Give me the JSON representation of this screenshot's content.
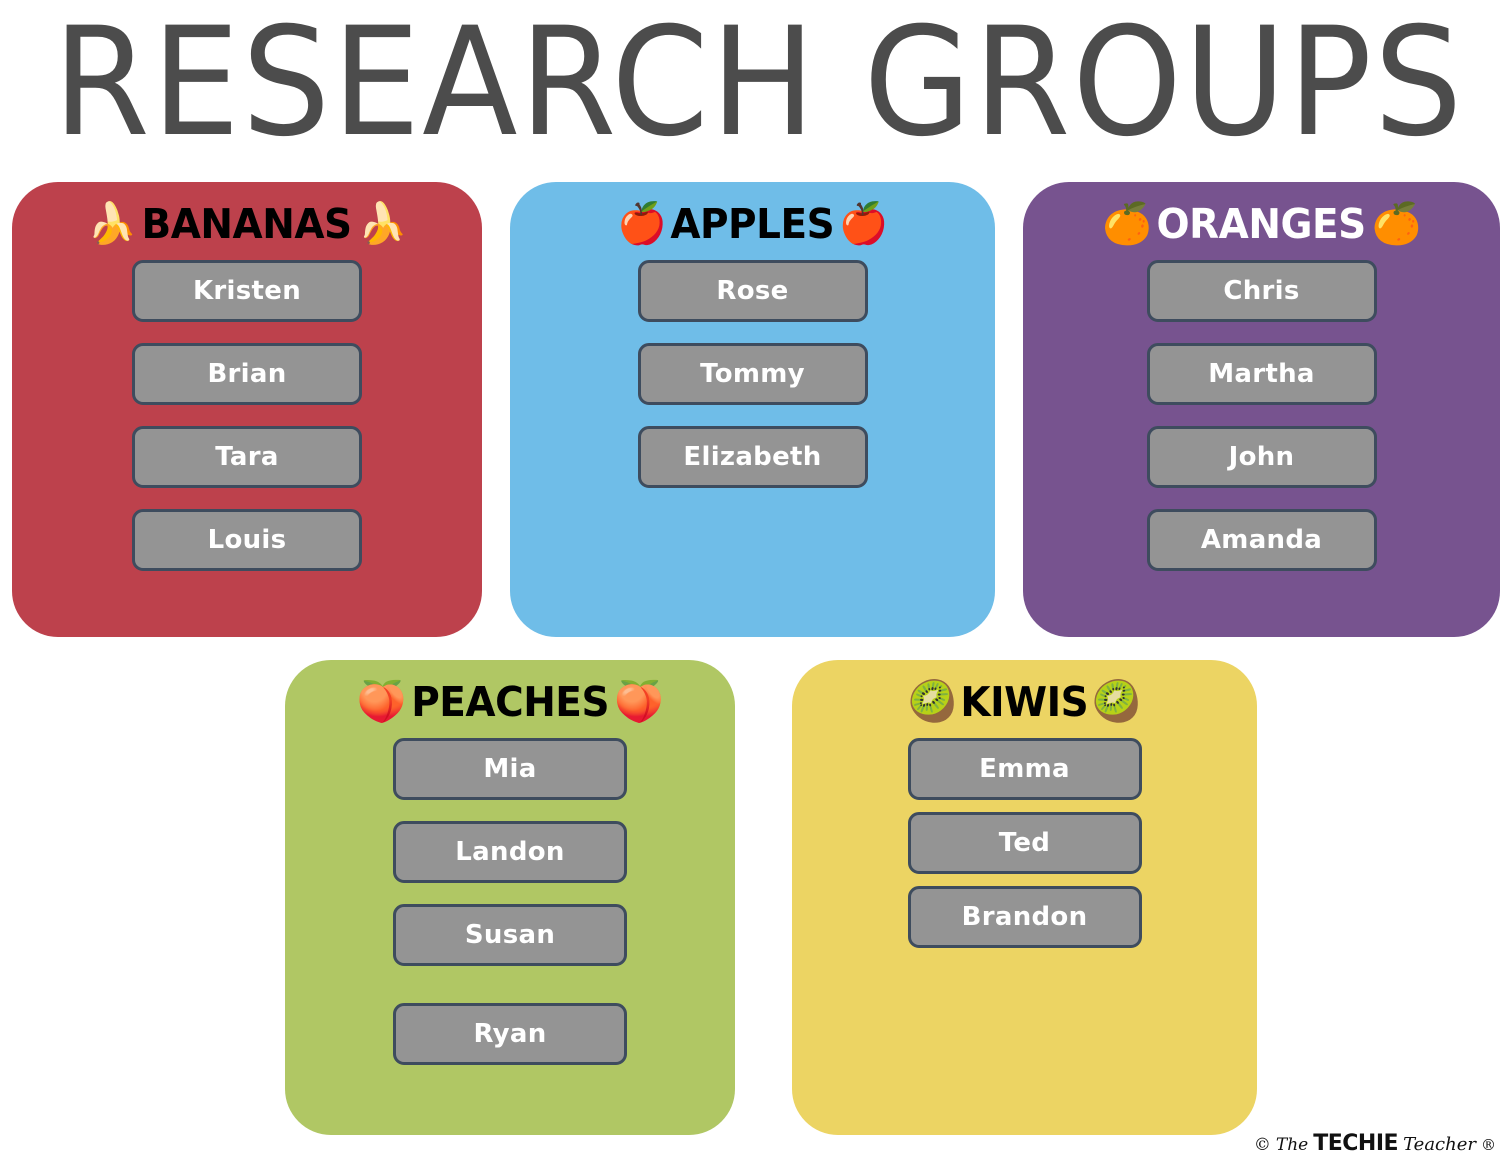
{
  "poster": {
    "title": "RESEARCH GROUPS",
    "title_color": "#4c4c4c",
    "background": "#ffffff"
  },
  "chip_style": {
    "fill": "#949494",
    "border": "#3e4c5e",
    "text_color": "#ffffff"
  },
  "groups": [
    {
      "id": "bananas",
      "label": "BANANAS",
      "emoji": "🍌",
      "emoji_name": "banana-emoji",
      "card_color": "#bd414c",
      "header_color": "#000000",
      "members": [
        "Kristen",
        "Brian",
        "Tara",
        "Louis"
      ]
    },
    {
      "id": "apples",
      "label": "APPLES",
      "emoji": "🍎",
      "emoji_name": "apple-emoji",
      "card_color": "#6fbde8",
      "header_color": "#000000",
      "members": [
        "Rose",
        "Tommy",
        "Elizabeth"
      ]
    },
    {
      "id": "oranges",
      "label": "ORANGES",
      "emoji": "🍊",
      "emoji_name": "orange-emoji",
      "card_color": "#77538f",
      "header_color": "#ffffff",
      "members": [
        "Chris",
        "Martha",
        "John",
        "Amanda"
      ]
    },
    {
      "id": "peaches",
      "label": "PEACHES",
      "emoji": "🍑",
      "emoji_name": "peach-emoji",
      "card_color": "#b0c764",
      "header_color": "#000000",
      "members": [
        "Mia",
        "Landon",
        "Susan",
        "Ryan"
      ]
    },
    {
      "id": "kiwis",
      "label": "KIWIS",
      "emoji": "🥝",
      "emoji_name": "kiwi-emoji",
      "card_color": "#ecd463",
      "header_color": "#000000",
      "members": [
        "Emma",
        "Ted",
        "Brandon"
      ]
    }
  ],
  "watermark": {
    "copyright": "©",
    "the": "The",
    "techie": "TECHIE",
    "teacher": "Teacher",
    "registered": "®"
  }
}
